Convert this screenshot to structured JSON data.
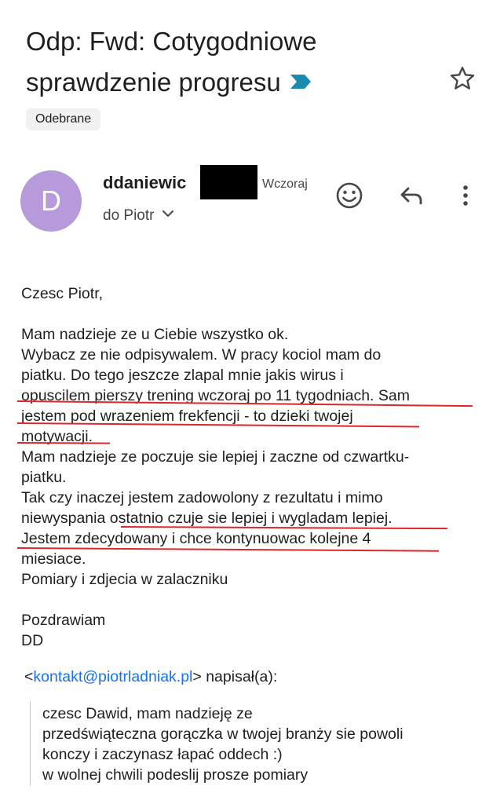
{
  "email": {
    "subject_line1": "Odp: Fwd: Cotygodniowe",
    "subject_line2": "sprawdzenie progresu",
    "label": "Odebrane",
    "avatar_letter": "D",
    "avatar_color": "#b79ad9",
    "sender_name": "ddaniewic",
    "date": "Wczoraj",
    "recipient": "do Piotr",
    "icons": {
      "important": "important-marker-icon",
      "star": "star-outline-icon",
      "emoji": "emoji-reaction-icon",
      "reply": "reply-icon",
      "more": "more-vert-icon",
      "expand": "chevron-down-icon"
    }
  },
  "body": {
    "greeting": "Czesc Piotr,",
    "lines": [
      "Mam nadzieje ze u Ciebie wszystko ok.",
      "Wybacz ze nie odpisywalem. W pracy kociol mam do",
      "piatku. Do tego jeszcze zlapal mnie jakis wirus i",
      "opuscilem pierszy trening wczoraj po 11 tygodniach. Sam",
      "jestem pod wrazeniem frekfencji - to dzieki twojej",
      "motywacji.",
      "Mam nadzieje ze poczuje sie lepiej i zaczne od czwartku-",
      "piatku.",
      "Tak czy inaczej jestem zadowolony z rezultatu i mimo",
      "niewyspania ostatnio czuje sie lepiej i wygladam lepiej.",
      "Jestem zdecydowany i chce kontynuowac kolejne 4",
      "miesiace.",
      "Pomiary i zdjecia w zalaczniku"
    ],
    "signoff": "Pozdrawiam",
    "signature": "DD"
  },
  "quote": {
    "open_bracket": "<",
    "email_link": "kontakt@piotrladniak.pl",
    "wrote": "> napisał(a):",
    "lines": [
      "czesc Dawid, mam nadzieję ze",
      "przedświąteczna gorączka w twojej branży sie powoli",
      "konczy i zaczynasz łapać oddech :)",
      "w wolnej chwili podeslij prosze pomiary"
    ]
  },
  "colors": {
    "annotation_underline": "#e0262b",
    "link": "#1a73e8",
    "important_marker": "#1a8bb0"
  }
}
